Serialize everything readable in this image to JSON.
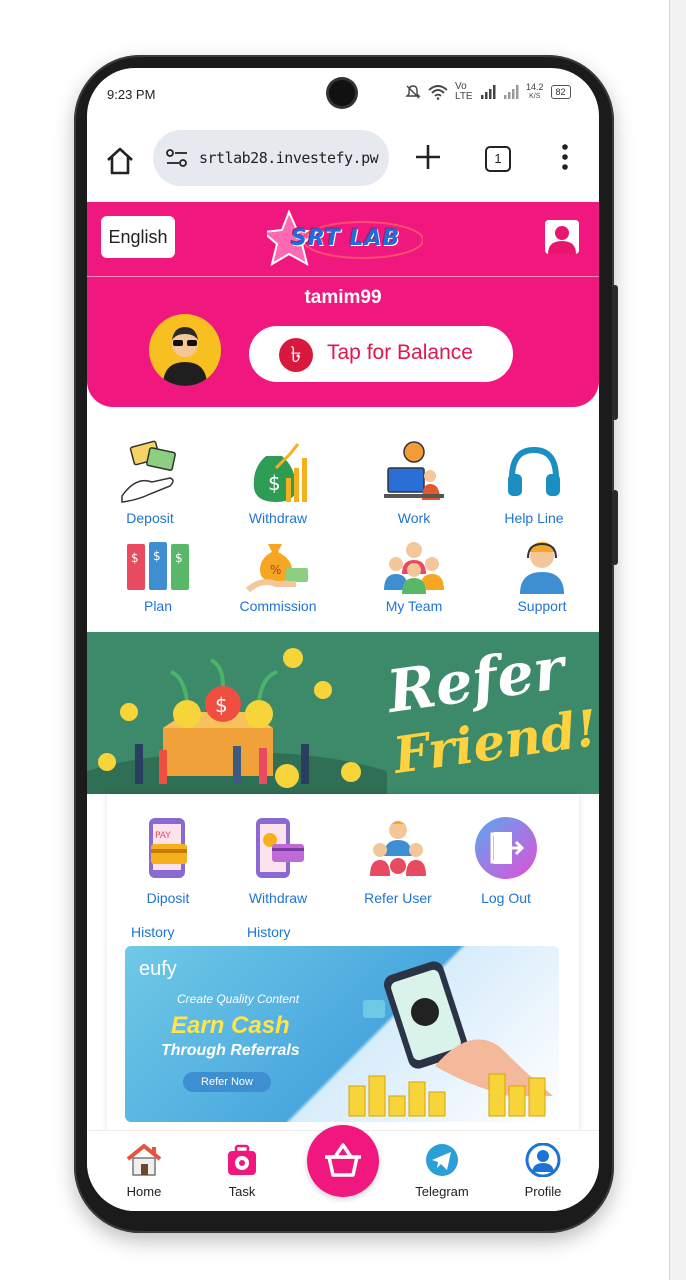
{
  "status_bar": {
    "time": "9:23 PM",
    "network": "Vo LTE",
    "speed_value": "14.2",
    "speed_unit": "K/S",
    "battery": "82"
  },
  "browser": {
    "url": "srtlab28.investefy.pw",
    "tab_count": "1"
  },
  "header": {
    "language_button": "English",
    "logo_text": "SRT LAB",
    "username": "tamim99",
    "balance_button": "Tap for Balance",
    "currency_symbol": "৳"
  },
  "main_menu": {
    "deposit": "Deposit",
    "withdraw": "Withdraw",
    "work": "Work",
    "help_line": "Help Line",
    "plan": "Plan",
    "commission": "Commission",
    "my_team": "My Team",
    "support": "Support"
  },
  "refer_banner": {
    "line1": "Refer",
    "line2": "Friend!"
  },
  "secondary_menu": {
    "deposit_history_1": "Diposit",
    "deposit_history_2": "History",
    "withdraw_history_1": "Withdraw",
    "withdraw_history_2": "History",
    "refer_user": "Refer User",
    "log_out": "Log Out"
  },
  "promo_banner": {
    "brand": "eufy",
    "line1": "Create Quality Content",
    "line2": "Earn Cash",
    "line3": "Through Referrals",
    "button": "Refer Now"
  },
  "bottom_nav": {
    "home": "Home",
    "task": "Task",
    "telegram": "Telegram",
    "profile": "Profile"
  },
  "colors": {
    "brand_pink": "#f0187f",
    "link_blue": "#1e74d4",
    "banner_green": "#3d8a6a"
  }
}
